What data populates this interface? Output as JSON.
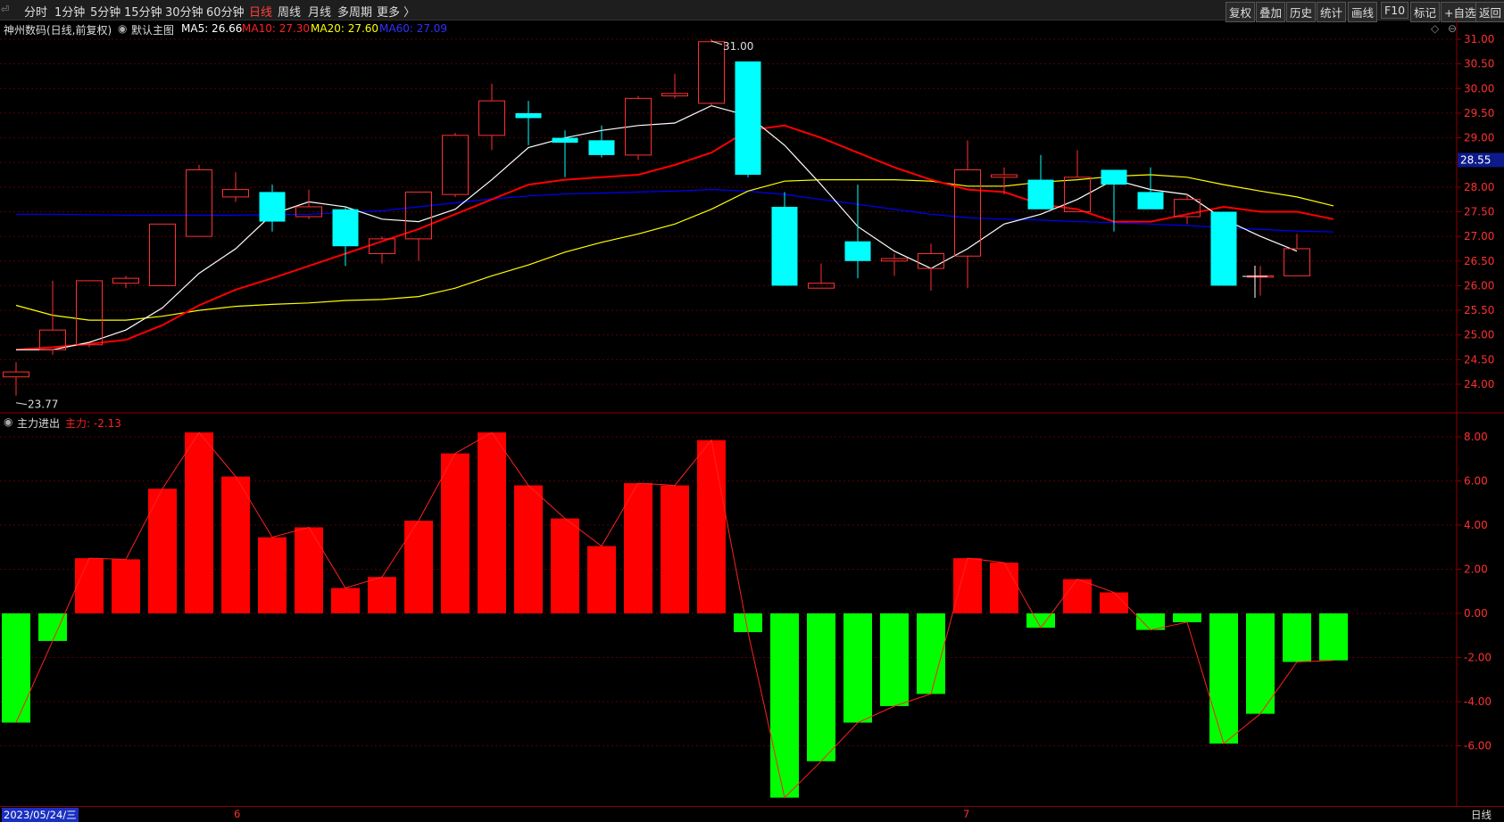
{
  "toolbar": {
    "periods": [
      "分时",
      "1分钟",
      "5分钟",
      "15分钟",
      "30分钟",
      "60分钟",
      "日线",
      "周线",
      "月线",
      "多周期",
      "更多 〉"
    ],
    "active_period": "日线",
    "right_buttons": [
      "复权",
      "叠加",
      "历史",
      "统计",
      "画线",
      "F10",
      "标记",
      "+自选",
      "返回"
    ]
  },
  "main_info": {
    "stock": "神州数码(日线,前复权)",
    "main_chart_label": "默认主图",
    "ma5": "MA5: 26.66",
    "ma10": "MA10: 27.30",
    "ma20": "MA20: 27.60",
    "ma60": "MA60: 27.09"
  },
  "indicator_info": {
    "name": "主力进出",
    "value": "主力: -2.13"
  },
  "price_axis": {
    "ticks": [
      "31.00",
      "30.50",
      "30.00",
      "29.50",
      "29.00",
      "28.50",
      "28.00",
      "27.50",
      "27.00",
      "26.50",
      "26.00",
      "25.50",
      "25.00",
      "24.50",
      "24.00"
    ],
    "current_price": "28.55"
  },
  "indicator_axis": {
    "ticks": [
      "8.00",
      "6.00",
      "4.00",
      "2.00",
      "0.00",
      "-2.00",
      "-4.00",
      "-6.00"
    ]
  },
  "annotations": {
    "high": "31.00",
    "low": "23.77"
  },
  "bottom": {
    "date": "2023/05/24/三",
    "month_labels": [
      "6",
      "7"
    ],
    "period_label": "日线"
  },
  "colors": {
    "up": "#ff3030",
    "down": "#00ffff",
    "ma5": "#ffffff",
    "ma10": "#ff0000",
    "ma20": "#ffff00",
    "ma60": "#0000ff",
    "ind_pos": "#ff0000",
    "ind_neg": "#00ff00"
  },
  "chart_data": {
    "type": "candlestick",
    "ohlc": [
      {
        "o": 24.15,
        "h": 24.45,
        "l": 23.77,
        "c": 24.25
      },
      {
        "o": 24.7,
        "h": 26.1,
        "l": 24.6,
        "c": 25.1
      },
      {
        "o": 24.8,
        "h": 26.1,
        "l": 24.75,
        "c": 26.1
      },
      {
        "o": 26.05,
        "h": 26.2,
        "l": 25.95,
        "c": 26.15
      },
      {
        "o": 26.0,
        "h": 27.25,
        "l": 26.0,
        "c": 27.25
      },
      {
        "o": 27.0,
        "h": 28.45,
        "l": 27.0,
        "c": 28.35
      },
      {
        "o": 27.8,
        "h": 28.3,
        "l": 27.7,
        "c": 27.95
      },
      {
        "o": 27.9,
        "h": 28.05,
        "l": 27.1,
        "c": 27.3
      },
      {
        "o": 27.4,
        "h": 27.95,
        "l": 27.35,
        "c": 27.6
      },
      {
        "o": 27.55,
        "h": 27.6,
        "l": 26.4,
        "c": 26.8
      },
      {
        "o": 26.65,
        "h": 27.0,
        "l": 26.45,
        "c": 26.95
      },
      {
        "o": 26.95,
        "h": 27.9,
        "l": 26.5,
        "c": 27.9
      },
      {
        "o": 27.85,
        "h": 29.1,
        "l": 27.8,
        "c": 29.05
      },
      {
        "o": 29.05,
        "h": 30.1,
        "l": 28.75,
        "c": 29.75
      },
      {
        "o": 29.5,
        "h": 29.75,
        "l": 28.85,
        "c": 29.4
      },
      {
        "o": 29.0,
        "h": 29.15,
        "l": 28.2,
        "c": 28.9
      },
      {
        "o": 28.95,
        "h": 29.25,
        "l": 28.6,
        "c": 28.65
      },
      {
        "o": 28.65,
        "h": 29.85,
        "l": 28.55,
        "c": 29.8
      },
      {
        "o": 29.85,
        "h": 30.3,
        "l": 29.8,
        "c": 29.9
      },
      {
        "o": 29.7,
        "h": 31.0,
        "l": 29.65,
        "c": 30.95
      },
      {
        "o": 30.55,
        "h": 30.55,
        "l": 28.2,
        "c": 28.25
      },
      {
        "o": 27.6,
        "h": 27.9,
        "l": 26.0,
        "c": 26.0
      },
      {
        "o": 25.95,
        "h": 26.45,
        "l": 25.95,
        "c": 26.05
      },
      {
        "o": 26.9,
        "h": 28.05,
        "l": 26.15,
        "c": 26.5
      },
      {
        "o": 26.5,
        "h": 26.65,
        "l": 26.2,
        "c": 26.55
      },
      {
        "o": 26.35,
        "h": 26.85,
        "l": 25.9,
        "c": 26.65
      },
      {
        "o": 26.6,
        "h": 28.95,
        "l": 25.95,
        "c": 28.35
      },
      {
        "o": 28.2,
        "h": 28.4,
        "l": 27.85,
        "c": 28.25
      },
      {
        "o": 28.15,
        "h": 28.65,
        "l": 27.55,
        "c": 27.55
      },
      {
        "o": 27.5,
        "h": 28.75,
        "l": 27.5,
        "c": 28.2
      },
      {
        "o": 28.35,
        "h": 28.35,
        "l": 27.1,
        "c": 28.05
      },
      {
        "o": 27.9,
        "h": 28.4,
        "l": 27.55,
        "c": 27.55
      },
      {
        "o": 27.4,
        "h": 27.85,
        "l": 27.25,
        "c": 27.75
      },
      {
        "o": 27.5,
        "h": 27.5,
        "l": 26.0,
        "c": 26.0
      },
      {
        "o": 26.2,
        "h": 26.4,
        "l": 25.8,
        "c": 26.2
      },
      {
        "o": 26.2,
        "h": 27.05,
        "l": 26.2,
        "c": 26.75
      }
    ],
    "ma5": [
      24.7,
      24.7,
      24.85,
      25.1,
      25.55,
      26.25,
      26.75,
      27.45,
      27.7,
      27.6,
      27.35,
      27.3,
      27.55,
      28.15,
      28.8,
      29.0,
      29.15,
      29.25,
      29.3,
      29.65,
      29.45,
      28.85,
      28.05,
      27.2,
      26.7,
      26.35,
      26.75,
      27.25,
      27.45,
      27.75,
      28.15,
      27.95,
      27.85,
      27.35,
      27.0,
      26.7
    ],
    "ma10": [
      24.7,
      24.75,
      24.82,
      24.9,
      25.2,
      25.6,
      25.92,
      26.15,
      26.4,
      26.65,
      26.9,
      27.15,
      27.45,
      27.75,
      28.05,
      28.15,
      28.2,
      28.25,
      28.45,
      28.7,
      29.15,
      29.25,
      29.0,
      28.7,
      28.4,
      28.15,
      27.95,
      27.9,
      27.65,
      27.55,
      27.3,
      27.3,
      27.45,
      27.6,
      27.5,
      27.5,
      27.35
    ],
    "ma20": [
      25.6,
      25.4,
      25.3,
      25.3,
      25.38,
      25.5,
      25.58,
      25.62,
      25.65,
      25.7,
      25.72,
      25.78,
      25.95,
      26.2,
      26.42,
      26.68,
      26.88,
      27.05,
      27.25,
      27.55,
      27.92,
      28.12,
      28.15,
      28.15,
      28.15,
      28.12,
      28.02,
      28.02,
      28.1,
      28.15,
      28.22,
      28.25,
      28.2,
      28.05,
      27.92,
      27.8,
      27.62
    ],
    "ma60": [
      27.45,
      27.45,
      27.44,
      27.43,
      27.43,
      27.43,
      27.43,
      27.44,
      27.45,
      27.48,
      27.52,
      27.6,
      27.68,
      27.76,
      27.82,
      27.86,
      27.88,
      27.9,
      27.92,
      27.95,
      27.92,
      27.85,
      27.75,
      27.65,
      27.55,
      27.45,
      27.38,
      27.35,
      27.33,
      27.3,
      27.28,
      27.25,
      27.22,
      27.18,
      27.14,
      27.11,
      27.09
    ],
    "indicator": [
      -4.95,
      -1.25,
      2.5,
      2.45,
      5.65,
      8.2,
      6.2,
      3.45,
      3.9,
      1.15,
      1.65,
      4.2,
      7.25,
      8.2,
      5.8,
      4.3,
      3.05,
      5.9,
      5.8,
      7.85,
      -0.85,
      -8.35,
      -6.7,
      -4.95,
      -4.2,
      -3.65,
      2.5,
      2.3,
      -0.65,
      1.55,
      0.95,
      -0.75,
      -0.4,
      -5.9,
      -4.55,
      -2.2,
      -2.13
    ],
    "price_range": [
      23.6,
      31.2
    ],
    "indicator_range": [
      -8.5,
      8.5
    ]
  }
}
